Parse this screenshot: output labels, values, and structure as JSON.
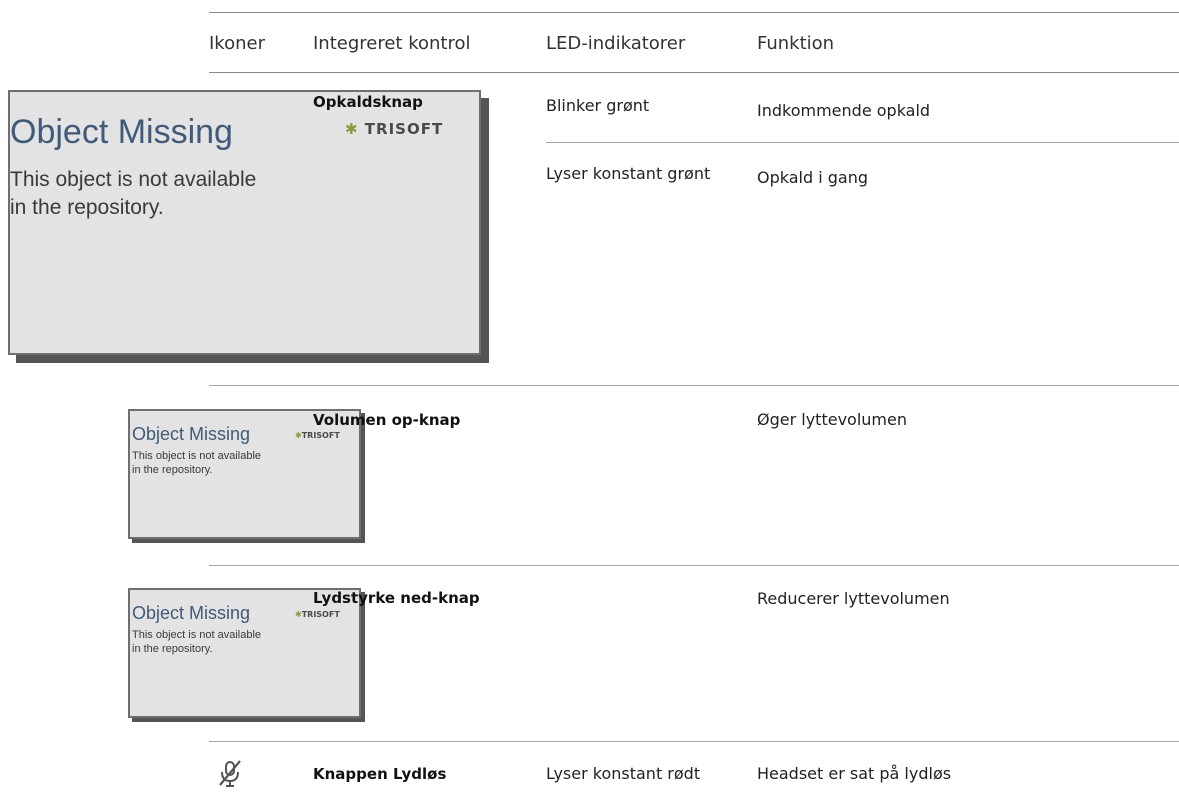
{
  "table": {
    "headers": {
      "icons": "Ikoner",
      "control": "Integreret kontrol",
      "led": "LED-indikatorer",
      "function": "Funktion"
    },
    "rows": [
      {
        "control": "Opkaldsknap",
        "entries": [
          {
            "led": "Blinker grønt",
            "function": "Indkommende opkald"
          },
          {
            "led": "Lyser konstant grønt",
            "function": "Opkald i gang"
          }
        ]
      },
      {
        "control": "Volumen op-knap",
        "led": "",
        "function": "Øger lyttevolumen"
      },
      {
        "control": "Lydstyrke ned-knap",
        "led": "",
        "function": "Reducerer lyttevolumen"
      },
      {
        "control": "Knappen Lydløs",
        "led": "Lyser konstant rødt",
        "function": "Headset er sat på lydløs",
        "icon": "mute-icon"
      }
    ]
  },
  "placeholder": {
    "title": "Object Missing",
    "line1": "This object is not available",
    "line2": "in the repository.",
    "logo": "TRISOFT"
  }
}
